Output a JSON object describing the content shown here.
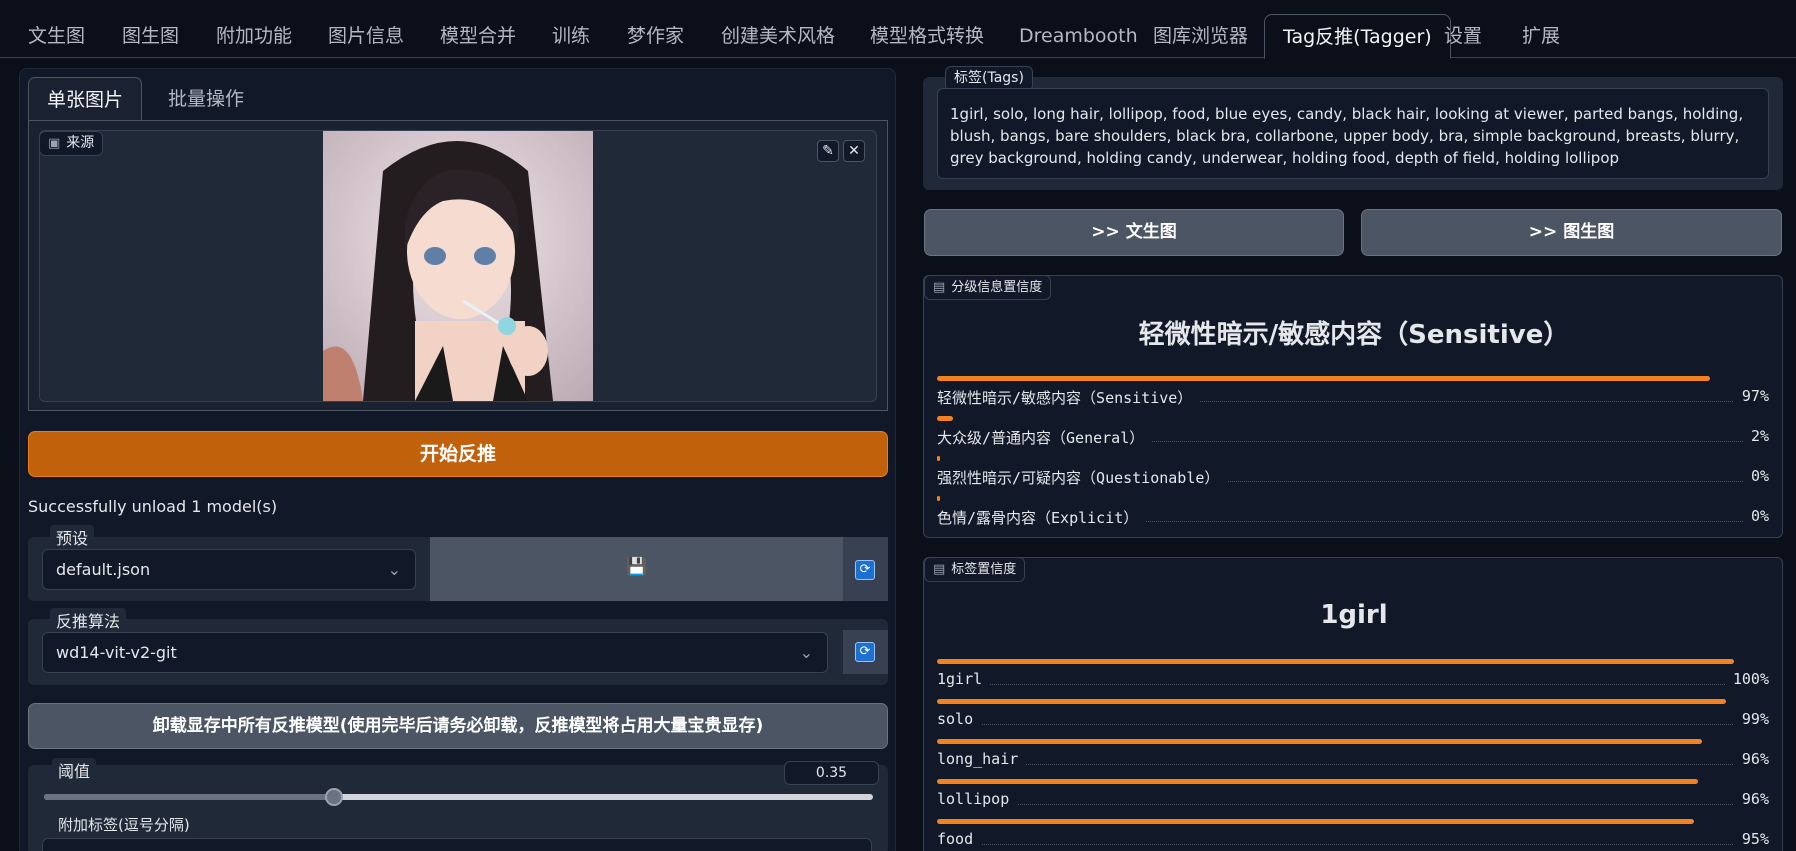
{
  "top_tabs": [
    "文生图",
    "图生图",
    "附加功能",
    "图片信息",
    "模型合并",
    "训练",
    "梦作家",
    "创建美术风格",
    "模型格式转换",
    "Dreambooth",
    "图库浏览器",
    "Tag反推(Tagger)",
    "设置",
    "扩展"
  ],
  "active_top_tab": "Tag反推(Tagger)",
  "sub_tabs": [
    "单张图片",
    "批量操作"
  ],
  "source_label": "来源",
  "interrogate_button": "开始反推",
  "status_text": "Successfully unload 1 model(s)",
  "preset": {
    "label": "预设",
    "value": "default.json",
    "save_icon": "💾"
  },
  "interrogator": {
    "label": "反推算法",
    "value": "wd14-vit-v2-git"
  },
  "unload_button": "卸载显存中所有反推模型(使用完毕后请务必卸载，反推模型将占用大量宝贵显存)",
  "threshold": {
    "label": "阈值",
    "value": "0.35",
    "fraction": 0.35
  },
  "additional_tags_label": "附加标签(逗号分隔)",
  "tags": {
    "label": "标签(Tags)",
    "text": "1girl, solo, long hair, lollipop, food, blue eyes, candy, black hair, looking at viewer, parted bangs, holding, blush, bangs, bare shoulders, black bra, collarbone, upper body, bra, simple background, breasts, blurry, grey background, holding candy, underwear, holding food, depth of field, holding lollipop"
  },
  "send_txt2img": ">> 文生图",
  "send_img2img": ">> 图生图",
  "rating": {
    "label": "分级信息置信度",
    "title": "轻微性暗示/敏感内容（Sensitive）",
    "items": [
      {
        "name": "轻微性暗示/敏感内容（Sensitive）",
        "value": "97%",
        "fraction": 0.97
      },
      {
        "name": "大众级/普通内容（General）",
        "value": "2%",
        "fraction": 0.02
      },
      {
        "name": "强烈性暗示/可疑内容（Questionable）",
        "value": "0%",
        "fraction": 0.003
      },
      {
        "name": "色情/露骨内容（Explicit）",
        "value": "0%",
        "fraction": 0.0
      }
    ]
  },
  "tag_confidence": {
    "label": "标签置信度",
    "title": "1girl",
    "items": [
      {
        "name": "1girl",
        "value": "100%",
        "fraction": 1.0
      },
      {
        "name": "solo",
        "value": "99%",
        "fraction": 0.99
      },
      {
        "name": "long_hair",
        "value": "96%",
        "fraction": 0.96
      },
      {
        "name": "lollipop",
        "value": "96%",
        "fraction": 0.955
      },
      {
        "name": "food",
        "value": "95%",
        "fraction": 0.95
      }
    ]
  },
  "colors": {
    "accent": "#f58220",
    "primary_button": "#c2610c",
    "background": "#0b0f19"
  }
}
